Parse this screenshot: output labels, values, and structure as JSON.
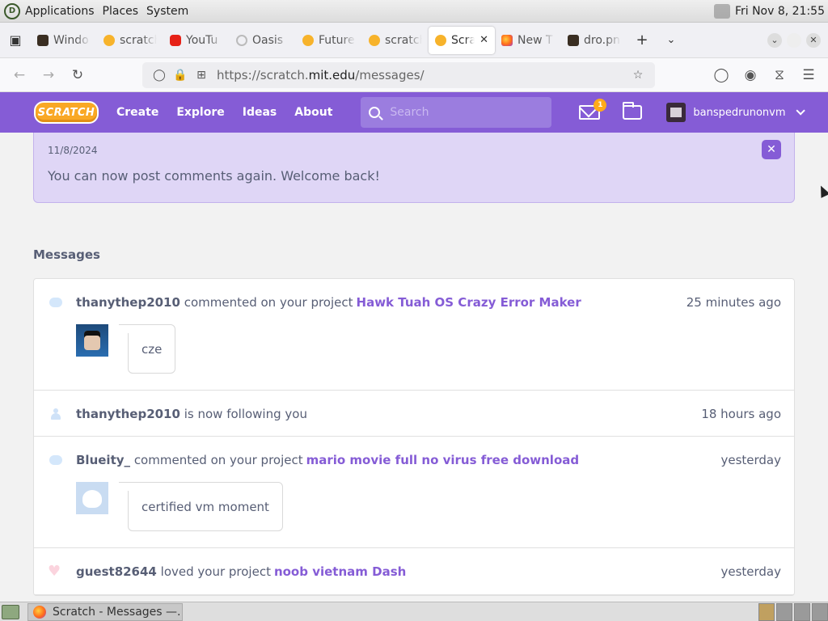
{
  "system_bar": {
    "menus": [
      "Applications",
      "Places",
      "System"
    ],
    "clock": "Fri Nov 8, 21:55"
  },
  "tabs": [
    {
      "label": "Windo",
      "favicon": "image-icon"
    },
    {
      "label": "scratch",
      "favicon": "scratch-icon"
    },
    {
      "label": "YouTu",
      "favicon": "youtube-icon"
    },
    {
      "label": "Oasis",
      "favicon": "oasis-icon"
    },
    {
      "label": "Future",
      "favicon": "scratch-icon"
    },
    {
      "label": "scratch",
      "favicon": "scratch-icon"
    },
    {
      "label": "Scra",
      "favicon": "scratch-icon",
      "active": true
    },
    {
      "label": "New T",
      "favicon": "firefox-icon"
    },
    {
      "label": "dro.pn",
      "favicon": "image-icon"
    }
  ],
  "address": {
    "prefix": "https://scratch.",
    "domain": "mit.edu",
    "path": "/messages/"
  },
  "scratch_nav": {
    "logo": "SCRATCH",
    "links": [
      "Create",
      "Explore",
      "Ideas",
      "About"
    ],
    "search_placeholder": "Search",
    "message_count": "1",
    "username": "banspedrunonvm"
  },
  "alert": {
    "date": "11/8/2024",
    "text": "You can now post comments again. Welcome back!"
  },
  "messages_title": "Messages",
  "messages": [
    {
      "type": "comment",
      "user": "thanythep2010",
      "action": "commented on your project",
      "project": "Hawk Tuah OS Crazy Error Maker",
      "time": "25 minutes ago",
      "comment": "cze"
    },
    {
      "type": "follow",
      "user": "thanythep2010",
      "action": "is now following you",
      "project": "",
      "time": "18 hours ago",
      "comment": ""
    },
    {
      "type": "comment",
      "user": "Blueity_",
      "action": "commented on your project",
      "project": "mario movie full no virus free download",
      "time": "yesterday",
      "comment": "certified vm moment"
    },
    {
      "type": "love",
      "user": "guest82644",
      "action": "loved your project",
      "project": "noob vietnam Dash",
      "time": "yesterday",
      "comment": ""
    }
  ],
  "taskbar": {
    "task_label": "Scratch - Messages —..."
  }
}
